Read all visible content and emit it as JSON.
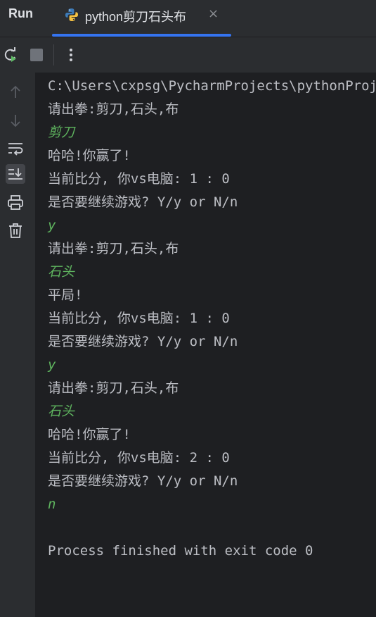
{
  "header": {
    "run_label": "Run",
    "tab_title": "python剪刀石头布",
    "tab_close": "×",
    "tab_icon": "python-icon"
  },
  "toolbar": {
    "rerun_icon": "rerun-icon",
    "stop_icon": "stop-icon",
    "more_icon": "more-vertical-icon"
  },
  "gutter": {
    "icons": [
      "arrow-up-icon",
      "arrow-down-icon",
      "soft-wrap-icon",
      "scroll-to-end-icon",
      "print-icon",
      "trash-icon"
    ]
  },
  "console": {
    "lines": [
      {
        "text": "C:\\Users\\cxpsg\\PycharmProjects\\pythonProject\\venv\\Scripts\\python.exe",
        "kind": "output"
      },
      {
        "text": "请出拳:剪刀,石头,布",
        "kind": "output"
      },
      {
        "text": "剪刀",
        "kind": "input"
      },
      {
        "text": "哈哈!你赢了!",
        "kind": "output"
      },
      {
        "text": "当前比分, 你vs电脑: 1 : 0",
        "kind": "output"
      },
      {
        "text": "是否要继续游戏? Y/y or N/n",
        "kind": "output"
      },
      {
        "text": "y",
        "kind": "input"
      },
      {
        "text": "请出拳:剪刀,石头,布",
        "kind": "output"
      },
      {
        "text": "石头",
        "kind": "input"
      },
      {
        "text": "平局!",
        "kind": "output"
      },
      {
        "text": "当前比分, 你vs电脑: 1 : 0",
        "kind": "output"
      },
      {
        "text": "是否要继续游戏? Y/y or N/n",
        "kind": "output"
      },
      {
        "text": "y",
        "kind": "input"
      },
      {
        "text": "请出拳:剪刀,石头,布",
        "kind": "output"
      },
      {
        "text": "石头",
        "kind": "input"
      },
      {
        "text": "哈哈!你赢了!",
        "kind": "output"
      },
      {
        "text": "当前比分, 你vs电脑: 2 : 0",
        "kind": "output"
      },
      {
        "text": "是否要继续游戏? Y/y or N/n",
        "kind": "output"
      },
      {
        "text": "n",
        "kind": "input"
      },
      {
        "text": "",
        "kind": "output"
      },
      {
        "text": "Process finished with exit code 0",
        "kind": "output"
      }
    ]
  }
}
